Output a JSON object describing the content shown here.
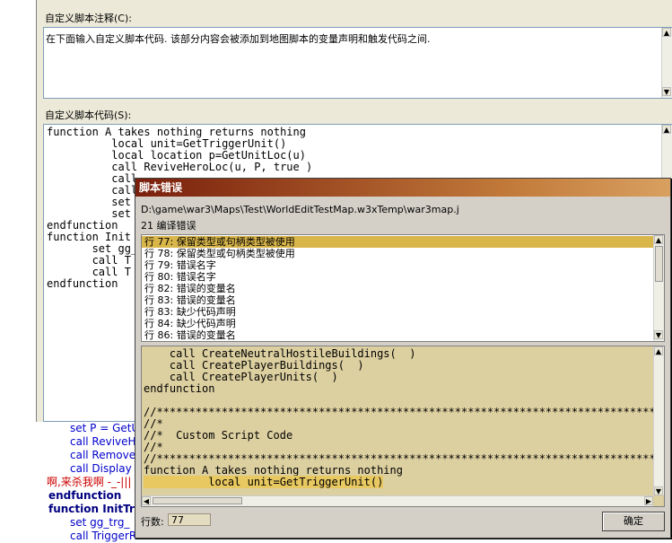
{
  "main": {
    "comment_label": "自定义脚本注释(C):",
    "comment_text": "在下面输入自定义脚本代码. 该部分内容会被添加到地图脚本的变量声明和触发代码之间.",
    "code_label": "自定义脚本代码(S):",
    "code_lines": [
      "function A takes nothing returns nothing",
      "          local unit=GetTriggerUnit()",
      "          local location p=GetUnitLoc(u)",
      "          call ReviveHeroLoc(u, P, true )",
      "          call",
      "          call",
      "          set",
      "          set",
      "endfunction",
      "function Init",
      "       set gg_",
      "       call T",
      "       call T",
      "endfunction"
    ]
  },
  "bottom_editor": {
    "lines": [
      {
        "text": "set P = GetU",
        "color": "#0000cc",
        "indent": 78
      },
      {
        "text": "call ReviveH",
        "color": "#0000cc",
        "indent": 78
      },
      {
        "text": "call Remove",
        "color": "#0000cc",
        "indent": 78
      },
      {
        "text": "call Display",
        "color": "#0000cc",
        "indent": 78
      },
      {
        "text": "啊,来杀我啊 -_-|||",
        "color": "#cc0000",
        "indent": 52
      },
      {
        "text": "endfunction",
        "color": "#000080",
        "indent": 54
      },
      {
        "text": "function InitTri",
        "color": "#000080",
        "indent": 54
      },
      {
        "text": "set gg_trg_",
        "color": "#0000cc",
        "indent": 78
      },
      {
        "text": "call TriggerR",
        "color": "#0000cc",
        "indent": 78
      }
    ]
  },
  "dialog": {
    "title": "脚本错误",
    "path": "D:\\game\\war3\\Maps\\Test\\WorldEditTestMap.w3xTemp\\war3map.j",
    "error_count": "21 编译错误",
    "errors": [
      "行 77: 保留类型或句柄类型被使用",
      "行 78: 保留类型或句柄类型被使用",
      "行 79: 错误名字",
      "行 80: 错误名字",
      "行 82: 错误的变量名",
      "行 83: 错误的变量名",
      "行 83: 缺少代码声明",
      "行 84: 缺少代码声明",
      "行 86: 错误的变量名"
    ],
    "selected_error_index": 0,
    "code_lines": [
      "    call CreateNeutralHostileBuildings(  )",
      "    call CreatePlayerBuildings(  )",
      "    call CreatePlayerUnits(  )",
      "endfunction",
      "",
      "//***********************************************************************************",
      "//*",
      "//*  Custom Script Code",
      "//*",
      "//***********************************************************************************",
      "function A takes nothing returns nothing",
      "          local unit=GetTriggerUnit()"
    ],
    "highlighted_code_line": 11,
    "line_label": "行数:",
    "line_value": "77",
    "ok_label": "确定"
  }
}
